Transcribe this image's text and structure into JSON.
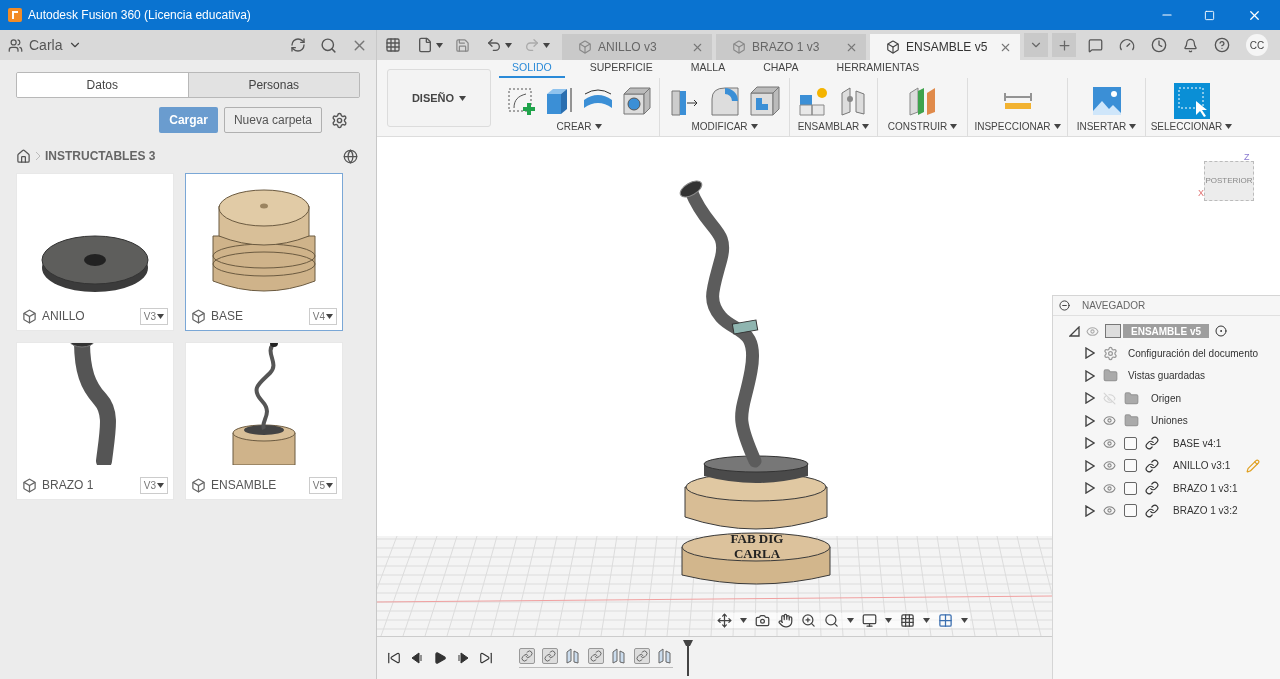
{
  "window": {
    "title": "Autodesk Fusion 360 (Licencia educativa)"
  },
  "data_panel": {
    "user": "Carla",
    "tabs": [
      {
        "label": "Datos",
        "selected": true
      },
      {
        "label": "Personas",
        "selected": false
      }
    ],
    "upload_button": "Cargar",
    "new_folder_button": "Nueva carpeta",
    "breadcrumb": "INSTRUCTABLES 3",
    "files": [
      {
        "name": "ANILLO",
        "version": "V3",
        "selected": false,
        "kind": "ring"
      },
      {
        "name": "BASE",
        "version": "V4",
        "selected": true,
        "kind": "base"
      },
      {
        "name": "BRAZO 1",
        "version": "V3",
        "selected": false,
        "kind": "arm"
      },
      {
        "name": "ENSAMBLE",
        "version": "V5",
        "selected": false,
        "kind": "assembly"
      }
    ]
  },
  "document_tabs": [
    {
      "label": "ANILLO v3",
      "selected": false
    },
    {
      "label": "BRAZO 1 v3",
      "selected": false
    },
    {
      "label": "ENSAMBLE v5",
      "selected": true
    }
  ],
  "user_initials": "CC",
  "toolbar": {
    "workspace": "DISEÑO",
    "tabs": [
      {
        "label": "SOLIDO",
        "selected": true
      },
      {
        "label": "SUPERFICIE",
        "selected": false
      },
      {
        "label": "MALLA",
        "selected": false
      },
      {
        "label": "CHAPA",
        "selected": false
      },
      {
        "label": "HERRAMIENTAS",
        "selected": false
      }
    ],
    "groups": [
      "CREAR",
      "MODIFICAR",
      "ENSAMBLAR",
      "CONSTRUIR",
      "INSPECCIONAR",
      "INSERTAR",
      "SELECCIONAR"
    ]
  },
  "viewcube": {
    "face": "POSTERIOR",
    "axis_up": "Z",
    "axis_side": "X"
  },
  "model": {
    "engraving": [
      "FAB DIG",
      "CARLA"
    ]
  },
  "navigator": {
    "title": "NAVEGADOR",
    "root": {
      "label": "ENSAMBLE v5",
      "expanded": true,
      "visible": true
    },
    "items": [
      {
        "label": "Configuración del documento",
        "kind": "settings",
        "editing": false
      },
      {
        "label": "Vistas guardadas",
        "kind": "views",
        "editing": false
      },
      {
        "label": "Origen",
        "kind": "folder",
        "visible": false,
        "editing": false
      },
      {
        "label": "Uniones",
        "kind": "folder",
        "visible": true,
        "editing": false
      },
      {
        "label": "BASE v4:1",
        "kind": "component",
        "visible": true,
        "editing": false
      },
      {
        "label": "ANILLO v3:1",
        "kind": "component",
        "visible": true,
        "editing": true
      },
      {
        "label": "BRAZO 1 v3:1",
        "kind": "component",
        "visible": true,
        "editing": false
      },
      {
        "label": "BRAZO 1 v3:2",
        "kind": "component",
        "visible": true,
        "editing": false
      }
    ]
  },
  "timeline": {
    "features": [
      {
        "kind": "joint"
      },
      {
        "kind": "joint"
      },
      {
        "kind": "motion"
      },
      {
        "kind": "joint"
      },
      {
        "kind": "motion"
      },
      {
        "kind": "joint"
      },
      {
        "kind": "motion"
      }
    ]
  }
}
